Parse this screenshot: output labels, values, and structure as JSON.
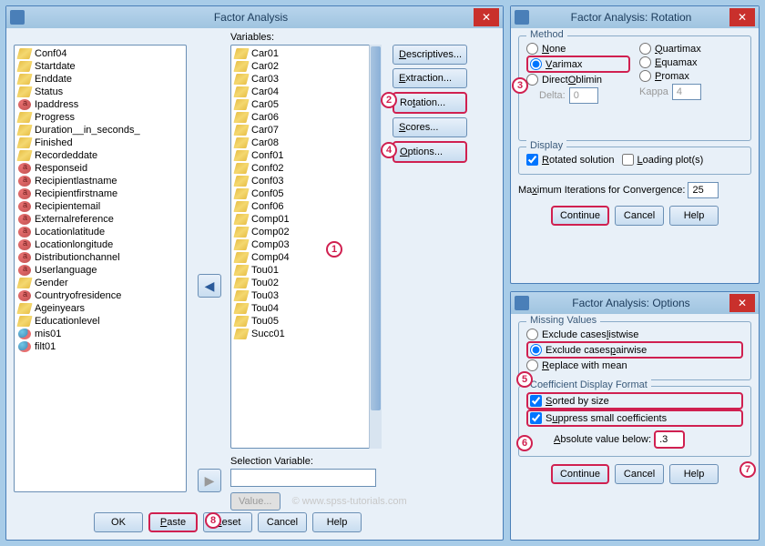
{
  "mainWindow": {
    "title": "Factor Analysis",
    "sourceLabel": "",
    "variablesLabel": "Variables:",
    "selectionLabel": "Selection Variable:",
    "sourceList": [
      {
        "t": "ruler",
        "n": "Conf04"
      },
      {
        "t": "ruler",
        "n": "Startdate"
      },
      {
        "t": "ruler",
        "n": "Enddate"
      },
      {
        "t": "ruler",
        "n": "Status"
      },
      {
        "t": "nominal",
        "n": "Ipaddress"
      },
      {
        "t": "ruler",
        "n": "Progress"
      },
      {
        "t": "ruler",
        "n": "Duration__in_seconds_"
      },
      {
        "t": "ruler",
        "n": "Finished"
      },
      {
        "t": "ruler",
        "n": "Recordeddate"
      },
      {
        "t": "nominal",
        "n": "Responseid"
      },
      {
        "t": "nominal",
        "n": "Recipientlastname"
      },
      {
        "t": "nominal",
        "n": "Recipientfirstname"
      },
      {
        "t": "nominal",
        "n": "Recipientemail"
      },
      {
        "t": "nominal",
        "n": "Externalreference"
      },
      {
        "t": "nominal",
        "n": "Locationlatitude"
      },
      {
        "t": "nominal",
        "n": "Locationlongitude"
      },
      {
        "t": "nominal",
        "n": "Distributionchannel"
      },
      {
        "t": "nominal",
        "n": "Userlanguage"
      },
      {
        "t": "ruler",
        "n": "Gender"
      },
      {
        "t": "nominal",
        "n": "Countryofresidence"
      },
      {
        "t": "ruler",
        "n": "Ageinyears"
      },
      {
        "t": "ruler",
        "n": "Educationlevel"
      },
      {
        "t": "nominal2",
        "n": "mis01"
      },
      {
        "t": "nominal2",
        "n": "filt01"
      }
    ],
    "varList": [
      {
        "t": "ruler",
        "n": "Car01"
      },
      {
        "t": "ruler",
        "n": "Car02"
      },
      {
        "t": "ruler",
        "n": "Car03"
      },
      {
        "t": "ruler",
        "n": "Car04"
      },
      {
        "t": "ruler",
        "n": "Car05"
      },
      {
        "t": "ruler",
        "n": "Car06"
      },
      {
        "t": "ruler",
        "n": "Car07"
      },
      {
        "t": "ruler",
        "n": "Car08"
      },
      {
        "t": "ruler",
        "n": "Conf01"
      },
      {
        "t": "ruler",
        "n": "Conf02"
      },
      {
        "t": "ruler",
        "n": "Conf03"
      },
      {
        "t": "ruler",
        "n": "Conf05"
      },
      {
        "t": "ruler",
        "n": "Conf06"
      },
      {
        "t": "ruler",
        "n": "Comp01"
      },
      {
        "t": "ruler",
        "n": "Comp02"
      },
      {
        "t": "ruler",
        "n": "Comp03"
      },
      {
        "t": "ruler",
        "n": "Comp04"
      },
      {
        "t": "ruler",
        "n": "Tou01"
      },
      {
        "t": "ruler",
        "n": "Tou02"
      },
      {
        "t": "ruler",
        "n": "Tou03"
      },
      {
        "t": "ruler",
        "n": "Tou04"
      },
      {
        "t": "ruler",
        "n": "Tou05"
      },
      {
        "t": "ruler",
        "n": "Succ01"
      }
    ],
    "sideButtons": {
      "descriptives": "Descriptives...",
      "extraction": "Extraction...",
      "rotation": "Rotation...",
      "scores": "Scores...",
      "options": "Options..."
    },
    "bottomButtons": {
      "ok": "OK",
      "paste": "Paste",
      "reset": "Reset",
      "cancel": "Cancel",
      "help": "Help"
    },
    "valueBtn": "Value...",
    "watermark": "© www.spss-tutorials.com"
  },
  "rotationWindow": {
    "title": "Factor Analysis: Rotation",
    "methodLegend": "Method",
    "methods": {
      "none": "None",
      "varimax": "Varimax",
      "directOblimin": "Direct Oblimin",
      "quartimax": "Quartimax",
      "equamax": "Equamax",
      "promax": "Promax"
    },
    "deltaLabel": "Delta:",
    "deltaVal": "0",
    "kappaLabel": "Kappa",
    "kappaVal": "4",
    "displayLegend": "Display",
    "rotatedSolution": "Rotated solution",
    "loadingPlots": "Loading plot(s)",
    "maxIterLabel": "Maximum Iterations for Convergence:",
    "maxIterVal": "25",
    "buttons": {
      "continue": "Continue",
      "cancel": "Cancel",
      "help": "Help"
    }
  },
  "optionsWindow": {
    "title": "Factor Analysis: Options",
    "missingLegend": "Missing Values",
    "missing": {
      "listwise": "Exclude cases listwise",
      "pairwise": "Exclude cases pairwise",
      "mean": "Replace with mean"
    },
    "coefLegend": "Coefficient Display Format",
    "sorted": "Sorted by size",
    "suppress": "Suppress small coefficients",
    "absLabel": "Absolute value below:",
    "absVal": ".3",
    "buttons": {
      "continue": "Continue",
      "cancel": "Cancel",
      "help": "Help"
    }
  }
}
